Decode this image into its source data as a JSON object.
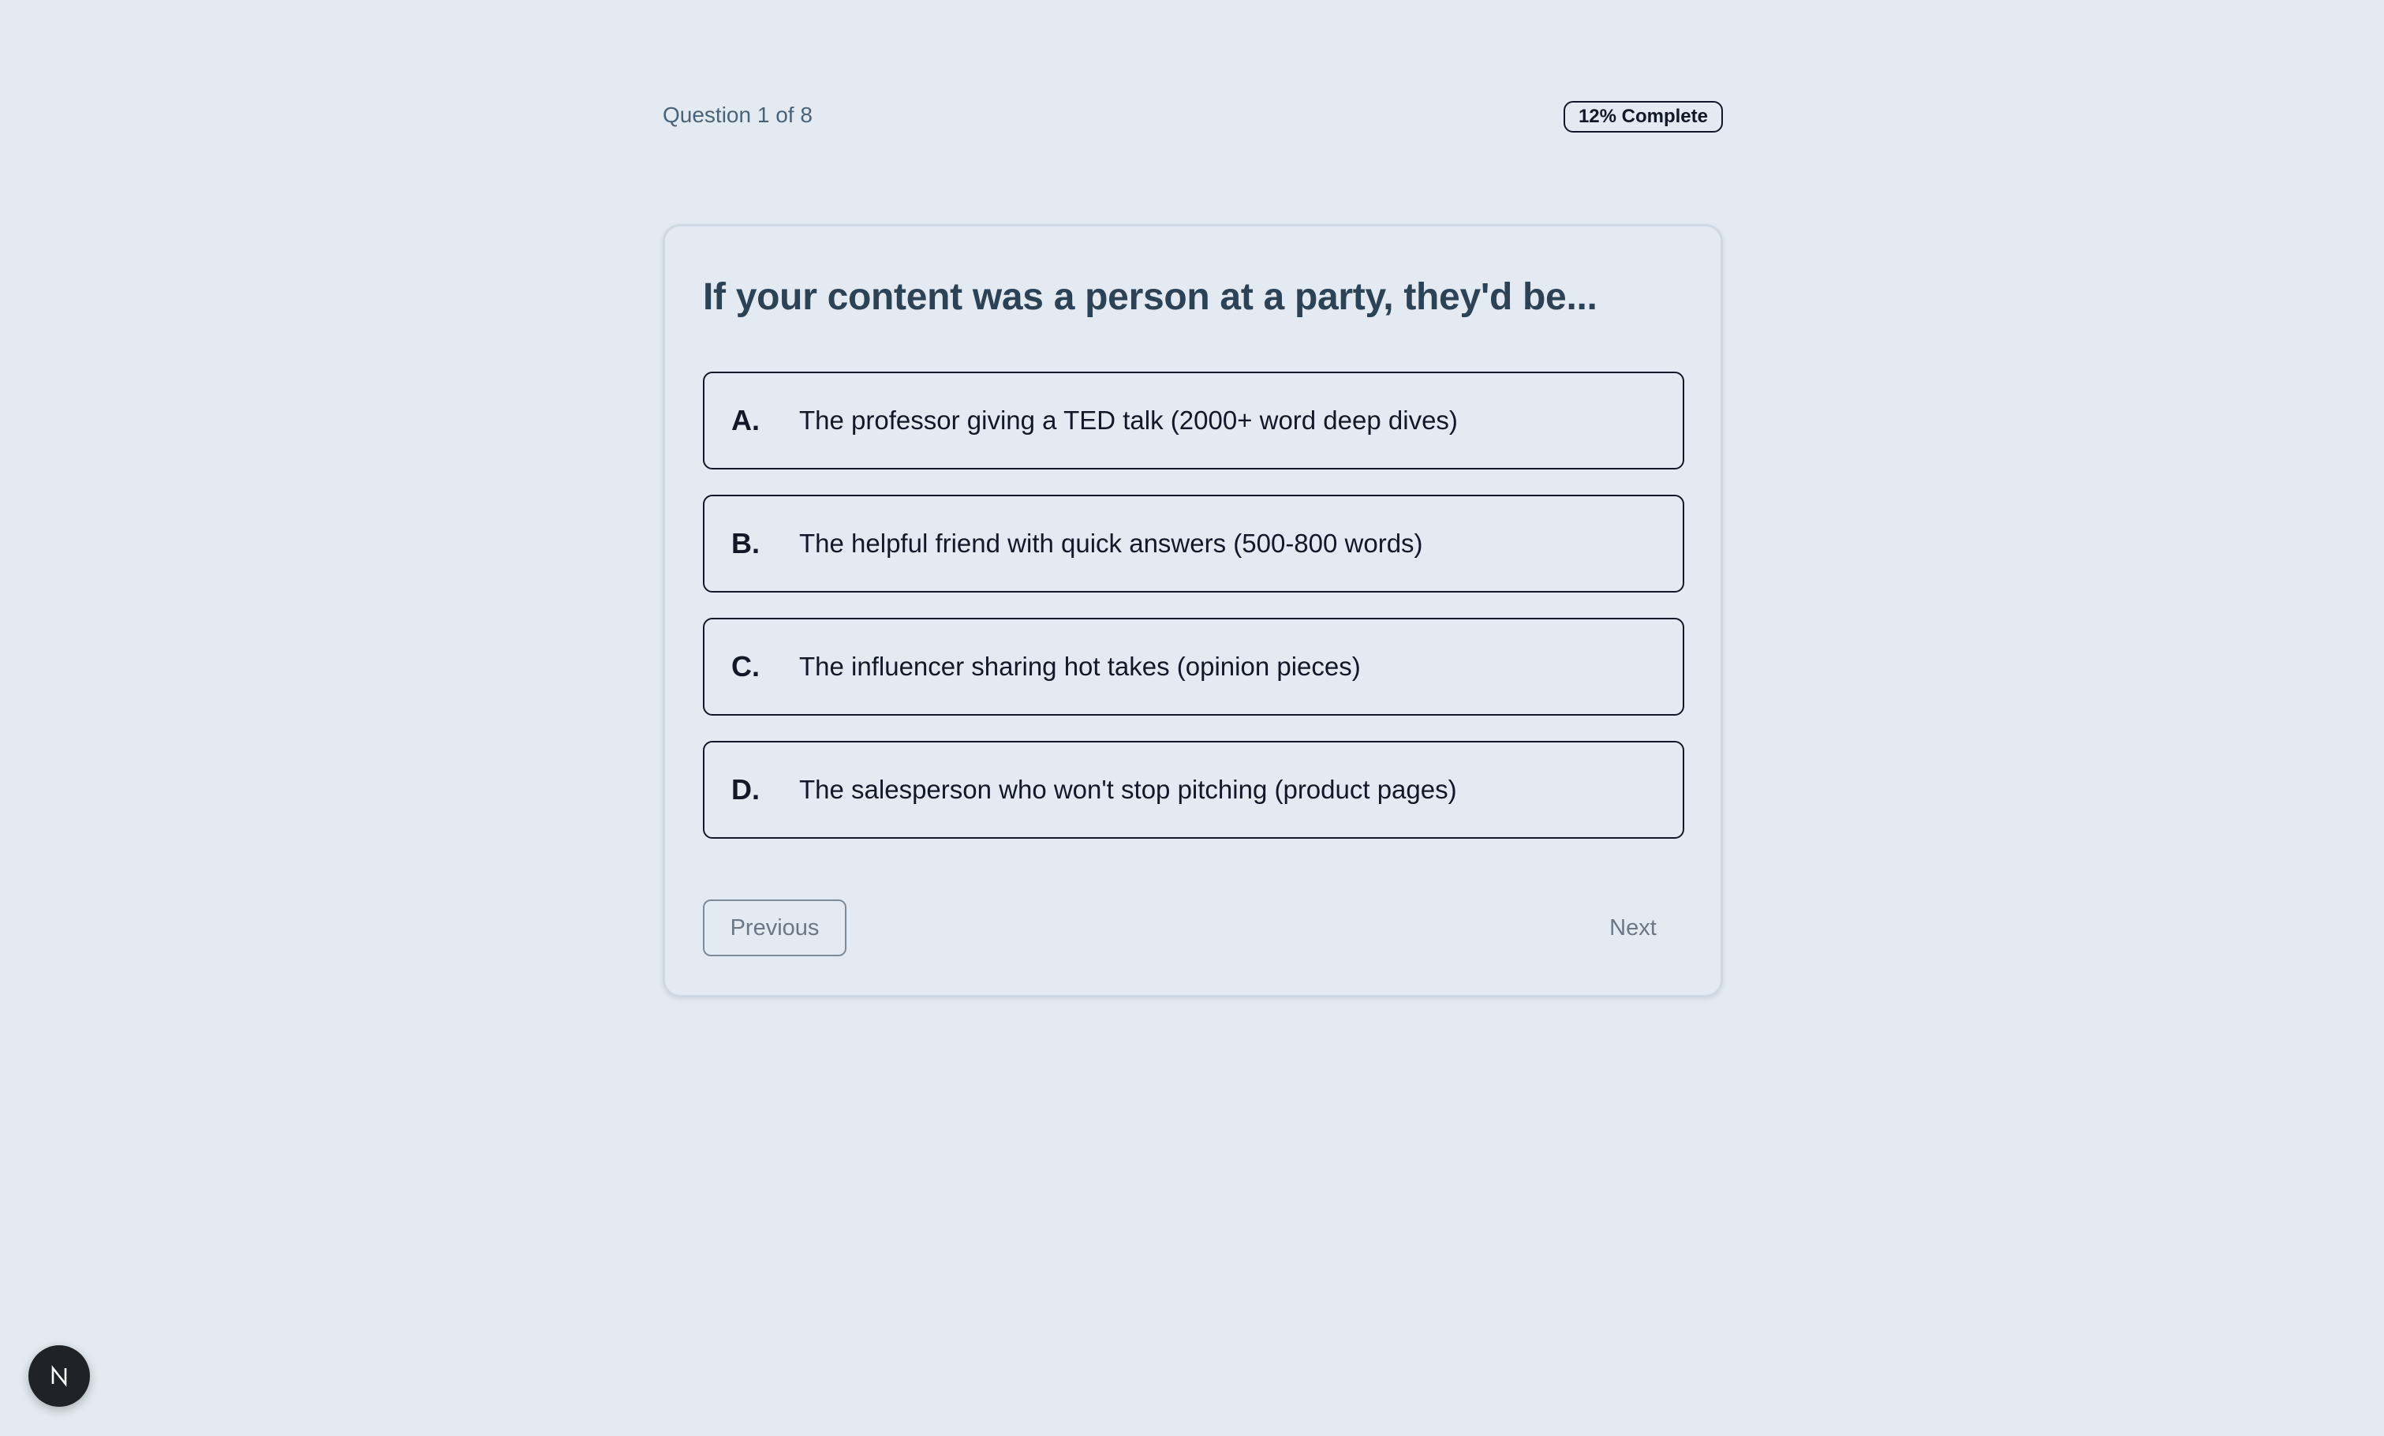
{
  "progress": {
    "question_label": "Question 1 of 8",
    "complete_label": "12% Complete",
    "current": 1,
    "total": 8,
    "percent": 12
  },
  "question": {
    "text": "If your content was a person at a party, they'd be..."
  },
  "options": [
    {
      "letter": "A.",
      "text": "The professor giving a TED talk (2000+ word deep dives)"
    },
    {
      "letter": "B.",
      "text": "The helpful friend with quick answers (500-800 words)"
    },
    {
      "letter": "C.",
      "text": "The influencer sharing hot takes (opinion pieces)"
    },
    {
      "letter": "D.",
      "text": "The salesperson who won't stop pitching (product pages)"
    }
  ],
  "nav": {
    "previous_label": "Previous",
    "next_label": "Next"
  },
  "dev_indicator": {
    "icon": "nextjs-logo-icon"
  },
  "colors": {
    "background": "#e3eaf1",
    "text_primary": "#111827",
    "question_text": "#2c4255",
    "muted": "#6b7785"
  }
}
